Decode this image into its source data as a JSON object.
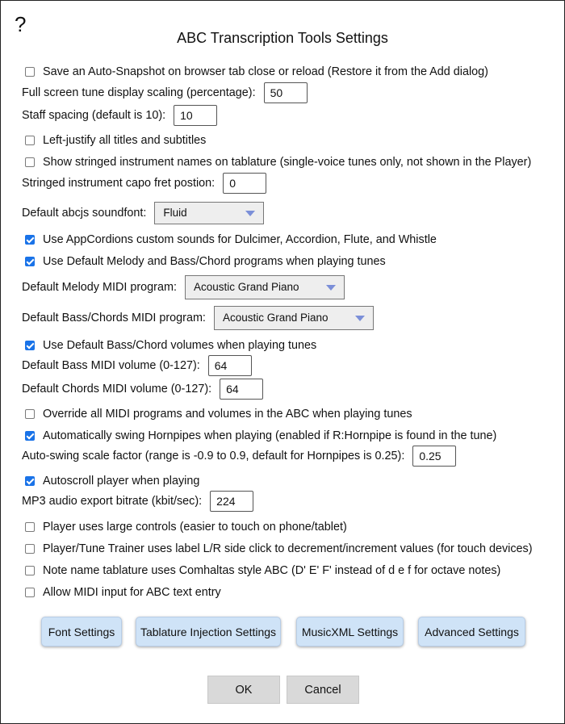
{
  "dialog": {
    "help_label": "?",
    "title": "ABC Transcription Tools Settings"
  },
  "settings": {
    "auto_snapshot": {
      "label": "Save an Auto-Snapshot on browser tab close or reload (Restore it from the Add dialog)",
      "checked": false
    },
    "fullscreen_scaling": {
      "label": "Full screen tune display scaling (percentage):",
      "value": "50"
    },
    "staff_spacing": {
      "label": "Staff spacing (default is 10):",
      "value": "10"
    },
    "left_justify": {
      "label": "Left-justify all titles and subtitles",
      "checked": false
    },
    "stringed_names": {
      "label": "Show stringed instrument names on tablature (single-voice tunes only, not shown in the Player)",
      "checked": false
    },
    "capo_fret": {
      "label": "Stringed instrument capo fret postion:",
      "value": "0"
    },
    "soundfont": {
      "label": "Default abcjs soundfont:",
      "selected": "Fluid"
    },
    "appcordions": {
      "label": "Use AppCordions custom sounds for Dulcimer, Accordion, Flute, and Whistle",
      "checked": true
    },
    "default_programs": {
      "label": "Use Default Melody and Bass/Chord programs when playing tunes",
      "checked": true
    },
    "melody_program": {
      "label": "Default Melody MIDI program:",
      "selected": "Acoustic Grand Piano"
    },
    "bass_program": {
      "label": "Default Bass/Chords MIDI program:",
      "selected": "Acoustic Grand Piano"
    },
    "default_volumes": {
      "label": "Use Default Bass/Chord volumes when playing tunes",
      "checked": true
    },
    "bass_volume": {
      "label": "Default Bass MIDI volume (0-127):",
      "value": "64"
    },
    "chords_volume": {
      "label": "Default Chords MIDI volume (0-127):",
      "value": "64"
    },
    "override_midi": {
      "label": "Override all MIDI programs and volumes in the ABC when playing tunes",
      "checked": false
    },
    "auto_swing": {
      "label": "Automatically swing Hornpipes when playing (enabled if R:Hornpipe is found in the tune)",
      "checked": true
    },
    "swing_factor": {
      "label": "Auto-swing scale factor (range is -0.9 to 0.9, default for Hornpipes is 0.25):",
      "value": "0.25"
    },
    "autoscroll": {
      "label": "Autoscroll player when playing",
      "checked": true
    },
    "mp3_bitrate": {
      "label": "MP3 audio export bitrate (kbit/sec):",
      "value": "224"
    },
    "large_controls": {
      "label": "Player uses large controls (easier to touch on phone/tablet)",
      "checked": false
    },
    "lr_click": {
      "label": "Player/Tune Trainer uses label L/R side click to decrement/increment values (for touch devices)",
      "checked": false
    },
    "comhaltas": {
      "label": "Note name tablature uses Comhaltas style ABC (D' E' F' instead of d e f for octave notes)",
      "checked": false
    },
    "midi_input": {
      "label": "Allow MIDI input for ABC text entry",
      "checked": false
    }
  },
  "buttons": {
    "font_settings": "Font Settings",
    "tablature_injection": "Tablature Injection Settings",
    "musicxml": "MusicXML Settings",
    "advanced": "Advanced Settings",
    "ok": "OK",
    "cancel": "Cancel"
  }
}
